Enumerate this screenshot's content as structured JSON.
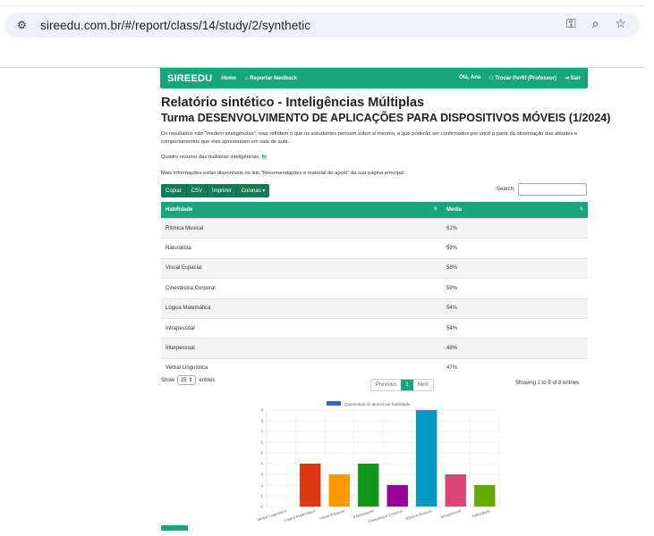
{
  "browser": {
    "url": "sireedu.com.br/#/report/class/14/study/2/synthetic"
  },
  "navbar": {
    "brand": "SIREEDU",
    "home": "Home",
    "feedback": "Reportar feedback",
    "greeting": "Olá, Ana",
    "switch_profile": "Trocar Perfil (Professor)",
    "logout": "Sair"
  },
  "page": {
    "title": "Relatório sintético - Inteligências Múltiplas",
    "subtitle": "Turma DESENVOLVIMENTO DE APLICAÇÕES PARA DISPOSITIVOS MÓVEIS (1/2024)",
    "intro": "Os resultados não \"medem inteligências\", mas refletem o que os estudantes pensam sobre si mesmo, e que poderão ser confirmados por você a partir da observação das atitudes e comportamentos que eles apresentam em sala de aula.",
    "summary_link": "Quadro resumo das múltiplas inteligências.",
    "more_info": "Mais informações estão disponíveis no link \"Recomendações e material de apoio\" da sua página principal."
  },
  "toolbar": {
    "copy": "Copiar",
    "csv": "CSV",
    "print": "Imprimir",
    "columns": "Colunas",
    "search_label": "Search:"
  },
  "table": {
    "headers": [
      "Habilidade",
      "Média"
    ],
    "rows": [
      [
        "Rítmica Musical",
        "61%"
      ],
      [
        "Naturalista",
        "59%"
      ],
      [
        "Visual Espacial",
        "58%"
      ],
      [
        "Cinestésica Corporal",
        "58%"
      ],
      [
        "Lógica Matemática",
        "54%"
      ],
      [
        "Intrapessoal",
        "54%"
      ],
      [
        "Interpessoal",
        "49%"
      ],
      [
        "Verbal Linguística",
        "47%"
      ]
    ]
  },
  "pagination": {
    "show": "Show",
    "page_size": "25",
    "entries": "entries",
    "previous": "Previous",
    "current": "1",
    "next": "Next",
    "info": "Showing 1 to 8 of 8 entries"
  },
  "chart_data": {
    "type": "bar",
    "legend": "Quantidade de alunos por habilidade",
    "legend_color": "#3366cc",
    "categories": [
      "Verbal Linguística",
      "Lógica Matemática",
      "Visual Espacial",
      "Interpessoal",
      "Cinestésica Corporal",
      "Rítmica Musical",
      "Intrapessoal",
      "Naturalista"
    ],
    "values": [
      0,
      4,
      3,
      4,
      2,
      9,
      3,
      2
    ],
    "colors": [
      "#3366cc",
      "#dc3912",
      "#ff9900",
      "#109618",
      "#990099",
      "#0099c6",
      "#dd4477",
      "#66aa00"
    ],
    "ylim": [
      0,
      9
    ],
    "yticks": [
      "0",
      "1",
      "2",
      "3",
      "4",
      "5",
      "6",
      "7",
      "8",
      "9"
    ],
    "grid": true
  }
}
